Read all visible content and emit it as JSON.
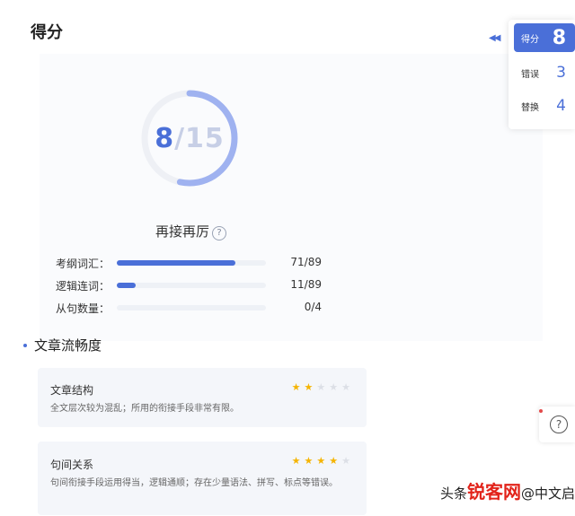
{
  "header": {
    "title": "得分"
  },
  "score": {
    "value": "8",
    "separator": "/",
    "total": "15",
    "progress": 0.5333
  },
  "level": {
    "label": "再接再厉",
    "help_symbol": "?"
  },
  "metrics": [
    {
      "label": "考纲词汇：",
      "value": "71/89",
      "fraction": 0.798
    },
    {
      "label": "逻辑连词：",
      "value": "11/89",
      "fraction": 0.124
    },
    {
      "label": "从句数量：",
      "value": "0/4",
      "fraction": 0
    }
  ],
  "section": {
    "title": "文章流畅度"
  },
  "cards": [
    {
      "title": "文章结构",
      "description": "全文层次较为混乱；所用的衔接手段非常有限。",
      "stars": 2,
      "max_stars": 5
    },
    {
      "title": "句间关系",
      "description": "句间衔接手段运用得当，逻辑通顺；存在少量语法、拼写、标点等错误。",
      "stars": 4,
      "max_stars": 5
    }
  ],
  "side_tabs": [
    {
      "label": "得分",
      "value": "8",
      "active": true
    },
    {
      "label": "错误",
      "value": "3",
      "active": false
    },
    {
      "label": "替换",
      "value": "4",
      "active": false
    }
  ],
  "collapse_symbol": "◀◀",
  "float_help": {
    "symbol": "?"
  },
  "watermark": {
    "prefix": "头条",
    "brand": "锐客网",
    "suffix": "@中文启动员"
  },
  "colors": {
    "accent": "#4a6fd8",
    "star": "#f5b400",
    "track": "#eef1f6"
  }
}
